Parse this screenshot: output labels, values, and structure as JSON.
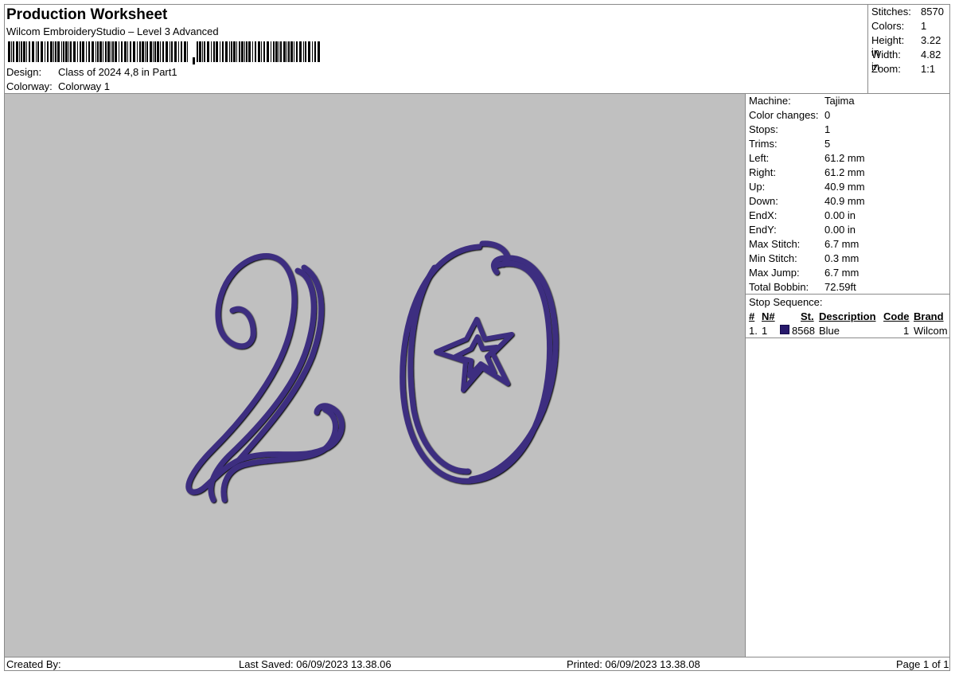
{
  "header": {
    "title": "Production Worksheet",
    "subtitle": "Wilcom EmbroideryStudio – Level 3 Advanced",
    "barcode_icon": "barcode-icon",
    "design_label": "Design:",
    "design_value": "Class of 2024 4,8 in Part1",
    "colorway_label": "Colorway:",
    "colorway_value": "Colorway 1"
  },
  "stats": {
    "stitches_label": "Stitches:",
    "stitches_value": "8570",
    "colors_label": "Colors:",
    "colors_value": "1",
    "height_label": "Height:",
    "height_value": "3.22 in",
    "width_label": "Width:",
    "width_value": "4.82 in",
    "zoom_label": "Zoom:",
    "zoom_value": "1:1"
  },
  "design_preview": {
    "thread_color": "#3d2f80",
    "background_color": "#c0c0c0",
    "shapes": [
      "digit-two",
      "digit-zero",
      "star-outline"
    ]
  },
  "machine_info": [
    {
      "label": "Machine:",
      "value": "Tajima"
    },
    {
      "label": "Color changes:",
      "value": "0"
    },
    {
      "label": "Stops:",
      "value": "1"
    },
    {
      "label": "Trims:",
      "value": "5"
    },
    {
      "label": "Left:",
      "value": "61.2 mm"
    },
    {
      "label": "Right:",
      "value": "61.2 mm"
    },
    {
      "label": "Up:",
      "value": "40.9 mm"
    },
    {
      "label": "Down:",
      "value": "40.9 mm"
    },
    {
      "label": "EndX:",
      "value": "0.00 in"
    },
    {
      "label": "EndY:",
      "value": "0.00 in"
    },
    {
      "label": "Max Stitch:",
      "value": "6.7 mm"
    },
    {
      "label": "Min Stitch:",
      "value": "0.3 mm"
    },
    {
      "label": "Max Jump:",
      "value": "6.7 mm"
    },
    {
      "label": "Total Bobbin:",
      "value": "72.59ft"
    }
  ],
  "stop_sequence": {
    "label": "Stop Sequence:",
    "columns": {
      "num": "#",
      "n": "N#",
      "st": "St.",
      "description": "Description",
      "code": "Code",
      "brand": "Brand"
    },
    "rows": [
      {
        "num": "1.",
        "n": "1",
        "st": "8568",
        "description": "Blue",
        "code": "1",
        "brand": "Wilcom",
        "color": "#27196b"
      }
    ]
  },
  "footer": {
    "created_by": "Created By:",
    "last_saved": "Last Saved: 06/09/2023 13.38.06",
    "printed": "Printed: 06/09/2023 13.38.08",
    "page": "Page 1 of 1"
  }
}
